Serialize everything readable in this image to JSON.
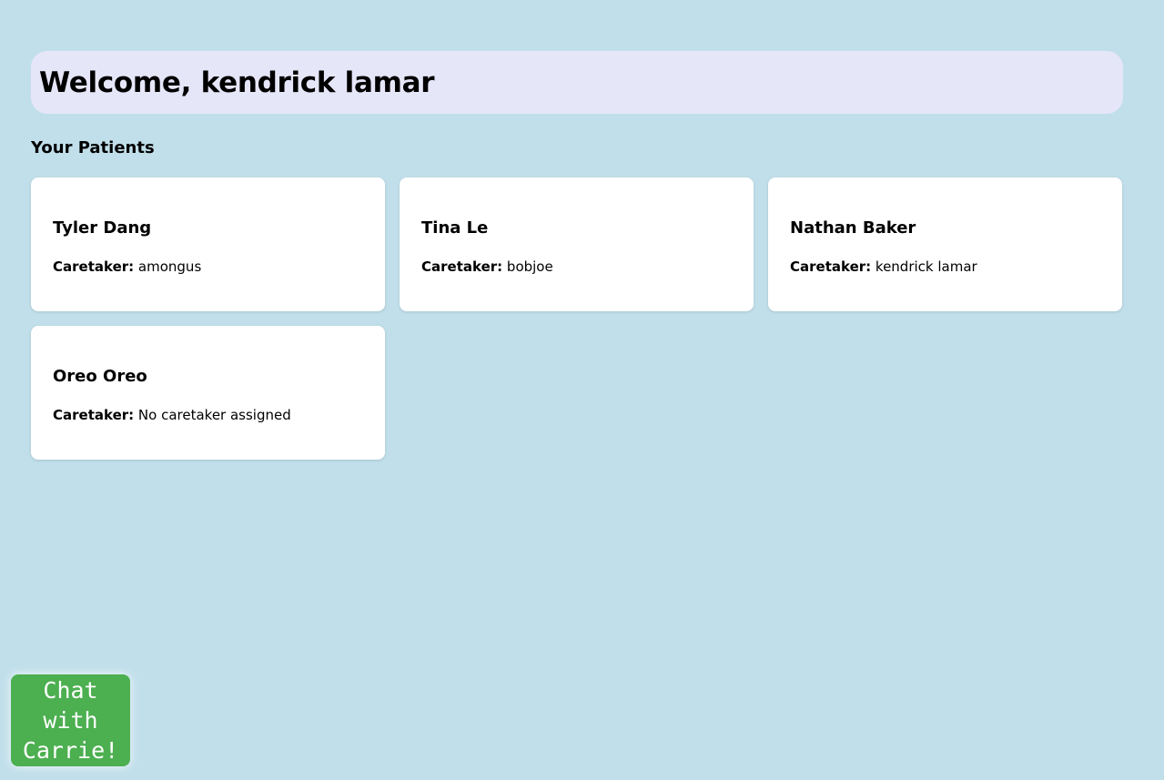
{
  "header": {
    "welcome_text": "Welcome, kendrick lamar"
  },
  "patients_section": {
    "title": "Your Patients",
    "caretaker_label": "Caretaker:",
    "patients": [
      {
        "name": "Tyler Dang",
        "caretaker": "amongus"
      },
      {
        "name": "Tina Le",
        "caretaker": "bobjoe"
      },
      {
        "name": "Nathan Baker",
        "caretaker": "kendrick lamar"
      },
      {
        "name": "Oreo Oreo",
        "caretaker": "No caretaker assigned"
      }
    ]
  },
  "chat_button": {
    "label": "Chat with Carrie!"
  },
  "colors": {
    "background": "#c1dfea",
    "banner": "#e6e6f9",
    "card": "#ffffff",
    "chat_button": "#4caf50"
  }
}
